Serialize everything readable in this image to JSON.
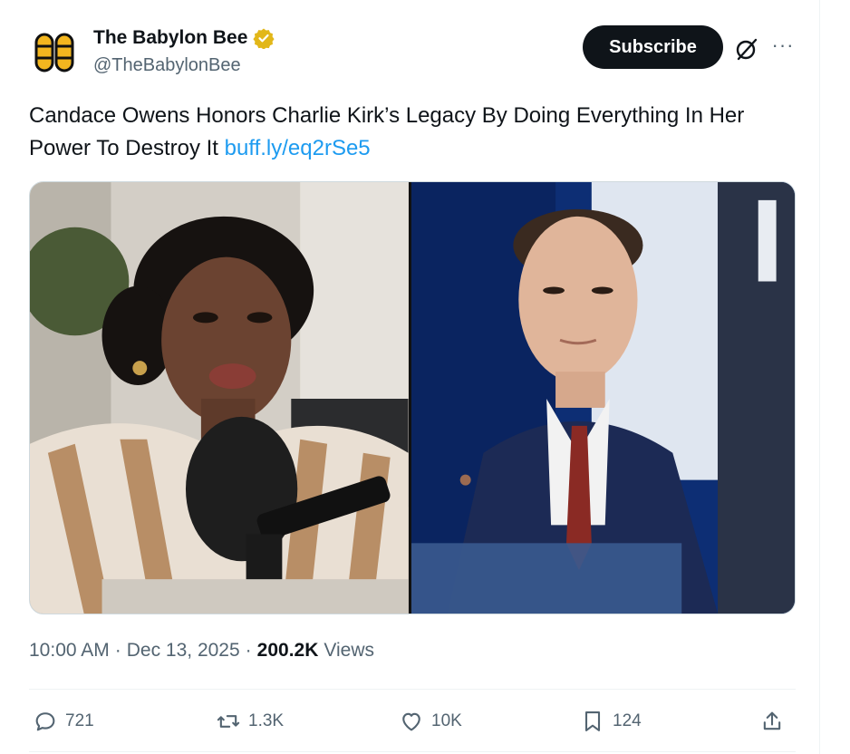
{
  "account": {
    "name": "The Babylon Bee",
    "handle": "@TheBabylonBee",
    "verified": true,
    "badge_color": "#e2b719"
  },
  "header": {
    "subscribe_label": "Subscribe",
    "more_label": "···"
  },
  "tweet": {
    "text": "Candace Owens Honors Charlie Kirk’s Legacy By Doing Everything In Her Power To Destroy It",
    "link": "buff.ly/eq2rSe5"
  },
  "meta": {
    "time": "10:00 AM",
    "dot1": "·",
    "date": "Dec 13, 2025",
    "dot2": "·",
    "views_count": "200.2K",
    "views_label": "Views"
  },
  "actions": {
    "replies": "721",
    "reposts": "1.3K",
    "likes": "10K",
    "bookmarks": "124"
  },
  "colors": {
    "text": "#0f1419",
    "secondary": "#536471",
    "link": "#1d9bf0",
    "button": "#0f1419"
  },
  "icons": {
    "logo": "bee-logo-icon",
    "verified": "verified-badge-icon",
    "grok": "grok-icon",
    "reply": "reply-icon",
    "repost": "repost-icon",
    "like": "heart-icon",
    "bookmark": "bookmark-icon",
    "share": "share-icon"
  }
}
